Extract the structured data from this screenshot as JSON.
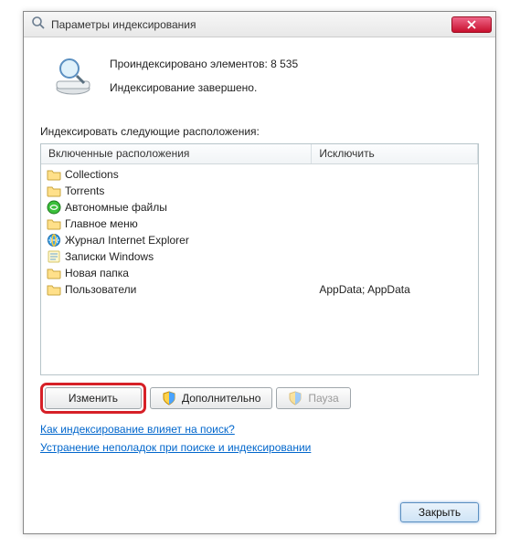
{
  "window": {
    "title": "Параметры индексирования"
  },
  "status": {
    "indexed_label": "Проиндексировано элементов: 8 535",
    "complete_label": "Индексирование завершено."
  },
  "section_label": "Индексировать следующие расположения:",
  "columns": {
    "included": "Включенные расположения",
    "excluded": "Исключить"
  },
  "locations": [
    {
      "icon": "folder",
      "name": "Collections",
      "excluded": ""
    },
    {
      "icon": "folder",
      "name": "Torrents",
      "excluded": ""
    },
    {
      "icon": "offline",
      "name": "Автономные файлы",
      "excluded": ""
    },
    {
      "icon": "folder",
      "name": "Главное меню",
      "excluded": ""
    },
    {
      "icon": "ie",
      "name": "Журнал Internet Explorer",
      "excluded": ""
    },
    {
      "icon": "notes",
      "name": "Записки Windows",
      "excluded": ""
    },
    {
      "icon": "folder",
      "name": "Новая папка",
      "excluded": ""
    },
    {
      "icon": "folder",
      "name": "Пользователи",
      "excluded": "AppData; AppData"
    }
  ],
  "buttons": {
    "modify": "Изменить",
    "advanced": "Дополнительно",
    "pause": "Пауза",
    "close": "Закрыть"
  },
  "links": {
    "howaffects": "Как индексирование влияет на поиск?",
    "troubleshoot": "Устранение неполадок при поиске и индексировании"
  }
}
